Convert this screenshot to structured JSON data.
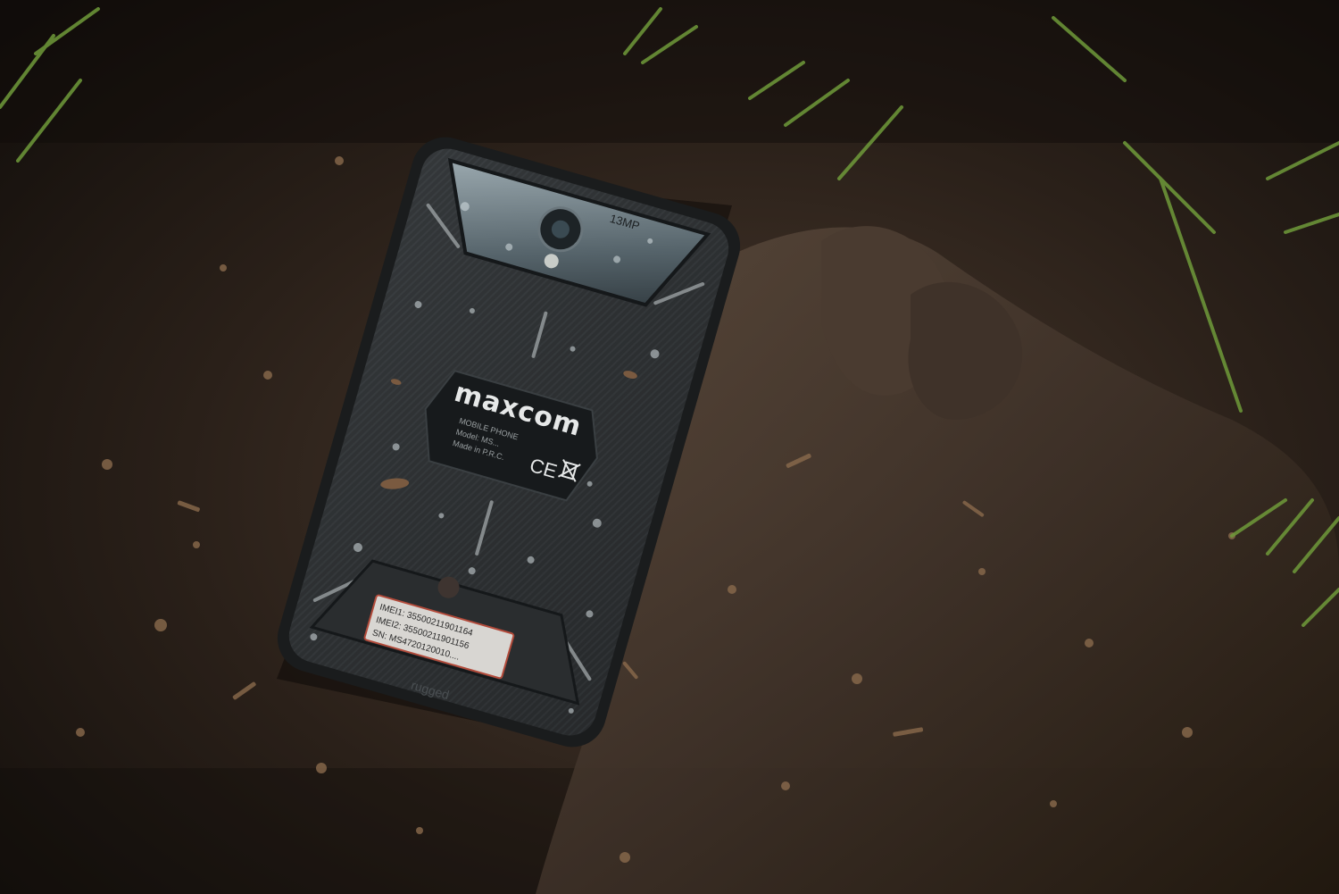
{
  "photo": {
    "subject": "rugged smartphone lying face-down in wet soil",
    "colors": {
      "soil_dark": "#1b1511",
      "soil_mid": "#3a2d24",
      "soil_light": "#6b5646",
      "grass": "#6f9a3a",
      "phone_body": "#2c2f31",
      "phone_edge": "#1a1c1d",
      "camera_glass": "#6f7f86",
      "label_bg": "#d8d6d2"
    }
  },
  "phone": {
    "logo": "maxcom",
    "cert_marks": "CE",
    "info_lines": [
      "MOBILE PHONE",
      "Model: MS...",
      "Made in P.R.C."
    ],
    "camera_label": "13MP",
    "bottom_text": "rugged",
    "sticker": {
      "imei1": "IMEI1: 35500211901164",
      "imei2": "IMEI2: 35500211901156",
      "sn": "SN: MS4720120010...."
    }
  }
}
